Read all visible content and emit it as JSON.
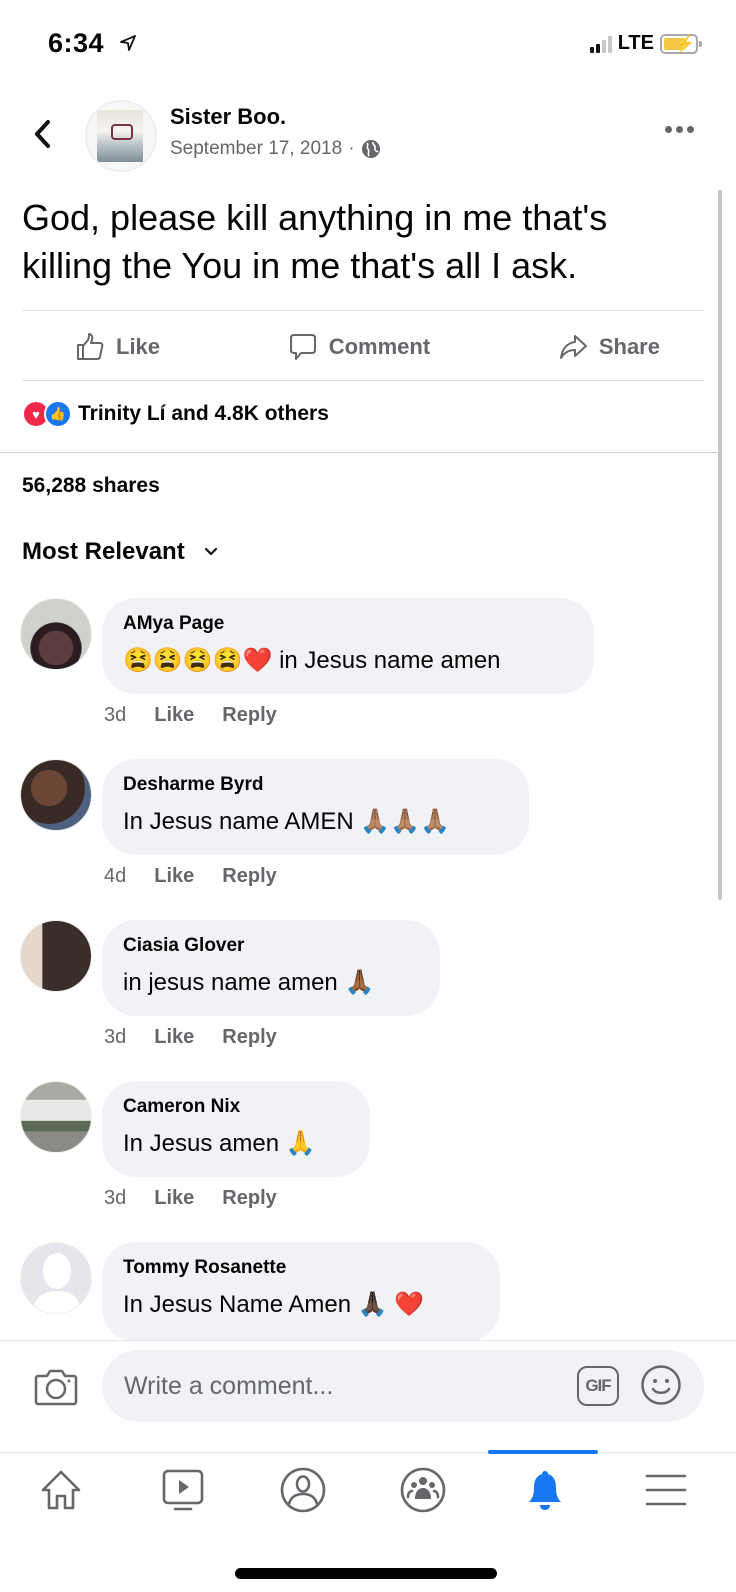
{
  "status_bar": {
    "time": "6:34",
    "network": "LTE",
    "signal_bars_active": 2,
    "signal_bars_total": 4,
    "battery_level": 0.7,
    "battery_charging": true
  },
  "header": {
    "back_icon": "chevron-left-icon",
    "author": "Sister Boo.",
    "date": "September 17, 2018",
    "separator": "·",
    "privacy_icon": "globe-icon",
    "more_icon": "more-horizontal-icon"
  },
  "post": {
    "text": "God, please kill anything in me that's killing the You in me that's all I ask."
  },
  "actions": {
    "like": "Like",
    "comment": "Comment",
    "share": "Share"
  },
  "reactions": {
    "types": [
      "love",
      "like"
    ],
    "summary": "Trinity Lí and 4.8K others"
  },
  "shares": "56,288 shares",
  "sort": {
    "label": "Most Relevant",
    "icon": "chevron-down-icon"
  },
  "comments": [
    {
      "name": "AMya Page",
      "text": "😫😫😫😫❤️ in Jesus name amen",
      "time": "3d",
      "like": "Like",
      "reply": "Reply"
    },
    {
      "name": "Desharme Byrd",
      "text": "In Jesus name AMEN 🙏🏽🙏🏽🙏🏽",
      "time": "4d",
      "like": "Like",
      "reply": "Reply"
    },
    {
      "name": "Ciasia Glover",
      "text": "in jesus name amen 🙏🏾",
      "time": "3d",
      "like": "Like",
      "reply": "Reply"
    },
    {
      "name": "Cameron Nix",
      "text": "In Jesus amen 🙏",
      "time": "3d",
      "like": "Like",
      "reply": "Reply"
    },
    {
      "name": "Tommy Rosanette",
      "text": "In Jesus Name Amen 🙏🏿 ❤️",
      "time": "",
      "like": "",
      "reply": ""
    }
  ],
  "composer": {
    "placeholder": "Write a comment...",
    "gif_label": "GIF",
    "camera_icon": "camera-icon",
    "emoji_icon": "smiley-icon"
  },
  "tab_bar": {
    "tabs": [
      {
        "name": "home",
        "icon": "home-icon",
        "active": false
      },
      {
        "name": "watch",
        "icon": "video-icon",
        "active": false
      },
      {
        "name": "profile",
        "icon": "profile-icon",
        "active": false
      },
      {
        "name": "groups",
        "icon": "groups-icon",
        "active": false
      },
      {
        "name": "notifications",
        "icon": "bell-icon",
        "active": true
      },
      {
        "name": "menu",
        "icon": "hamburger-menu-icon",
        "active": false
      }
    ]
  },
  "colors": {
    "accent": "#1877f2",
    "love": "#f0284a",
    "secondary_text": "#65676b",
    "bubble": "#f0f2f5"
  }
}
